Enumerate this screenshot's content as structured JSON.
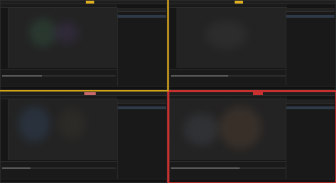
{
  "colors": {
    "accent": "#e0b020",
    "alert": "#c83030",
    "bg": "#141414",
    "divider_yellow": "#d4a417",
    "divider_red": "#c83030"
  },
  "windows": [
    {
      "id": "top-left",
      "badge": "",
      "menu": "",
      "panel_title": "",
      "panel_rows": [
        "",
        "",
        "",
        "",
        "",
        "",
        "",
        "",
        "",
        "",
        "",
        "",
        "",
        "",
        "",
        "",
        "",
        "",
        ""
      ],
      "timeline_label": "",
      "timeline_progress": 0.35,
      "status": ""
    },
    {
      "id": "top-right",
      "badge": "",
      "menu": "",
      "panel_title": "",
      "panel_rows": [
        "",
        "",
        "",
        "",
        "",
        "",
        "",
        "",
        "",
        "",
        "",
        "",
        "",
        "",
        "",
        "",
        "",
        ""
      ],
      "timeline_label": "",
      "timeline_progress": 0.5,
      "status": ""
    },
    {
      "id": "bottom-left",
      "badge": "",
      "menu": "",
      "panel_title": "",
      "panel_rows": [
        "",
        "",
        "",
        "",
        "",
        "",
        "",
        "",
        "",
        "",
        "",
        "",
        "",
        "",
        "",
        "",
        "",
        ""
      ],
      "timeline_label": "",
      "timeline_progress": 0.25,
      "status": ""
    },
    {
      "id": "bottom-right",
      "badge": "",
      "menu": "",
      "panel_title": "",
      "panel_rows": [
        "",
        "",
        "",
        "",
        "",
        "",
        "",
        "",
        "",
        "",
        "",
        "",
        "",
        "",
        "",
        "",
        "",
        ""
      ],
      "timeline_label": "",
      "timeline_progress": 0.6,
      "status": ""
    }
  ],
  "icons": [
    "menu-icon",
    "close-icon",
    "gear-icon",
    "play-icon"
  ]
}
